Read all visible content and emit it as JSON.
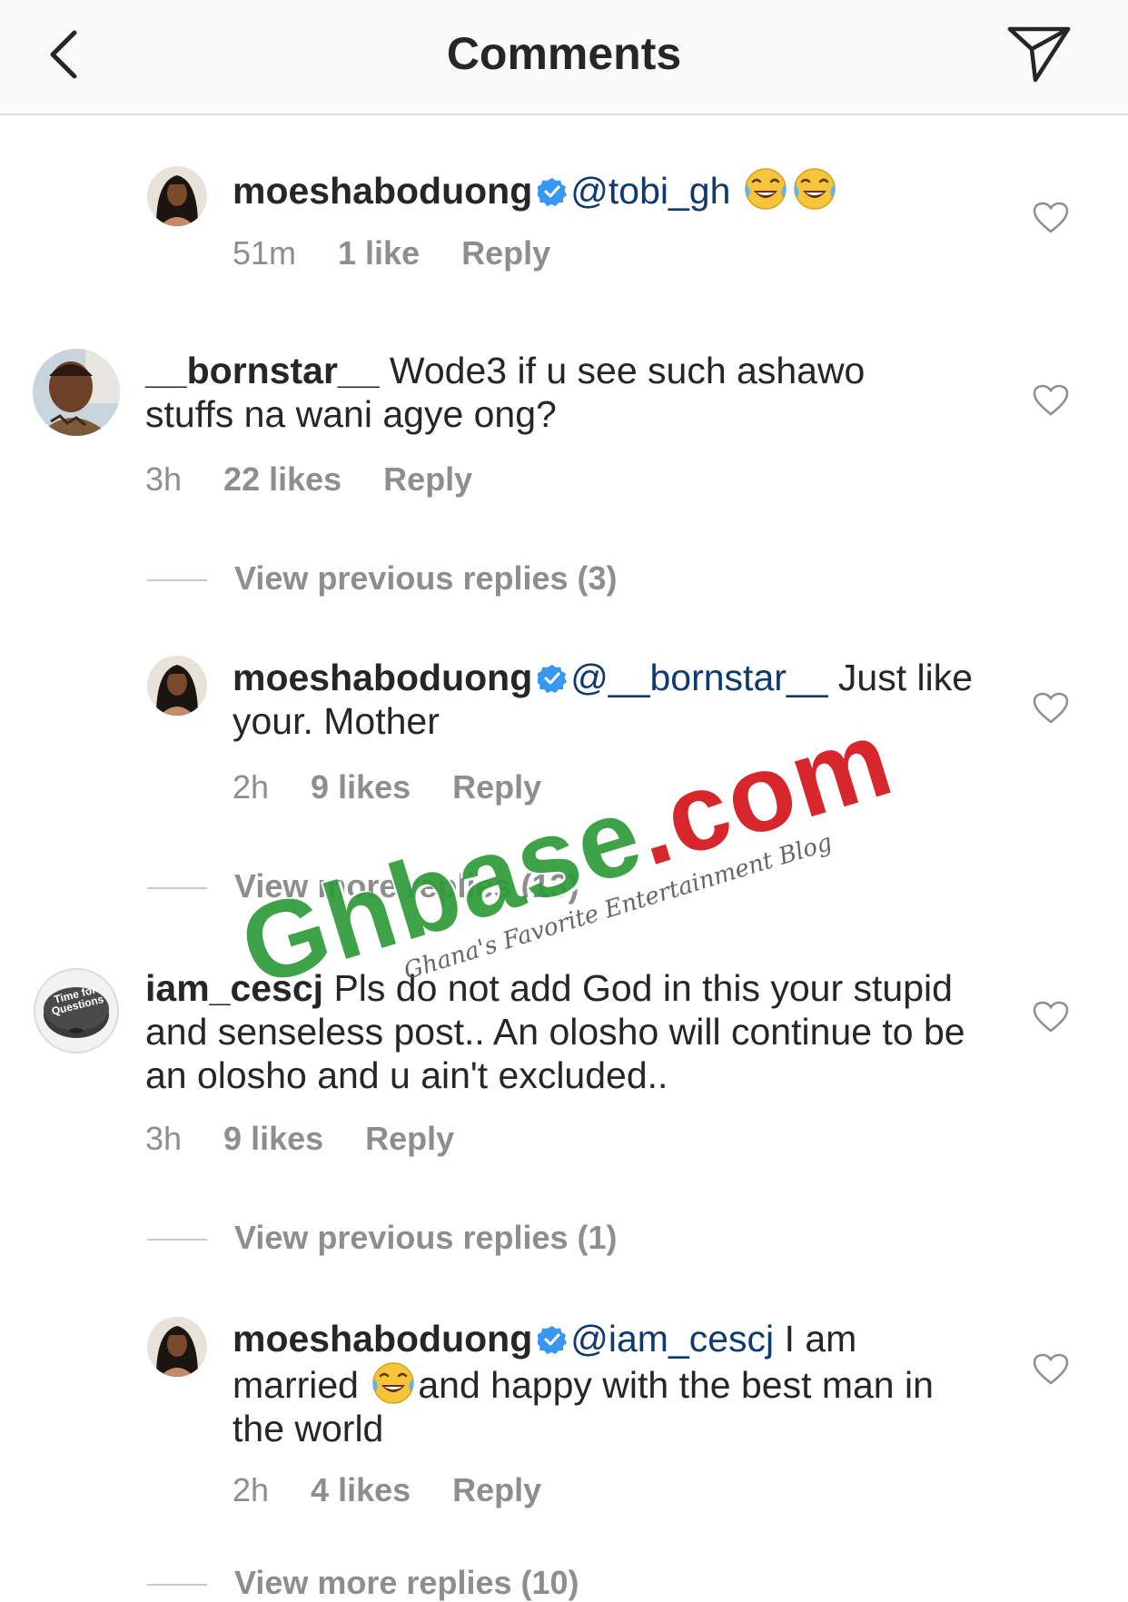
{
  "header": {
    "title": "Comments",
    "back_icon": "chevron-left-icon",
    "send_icon": "paper-plane-icon"
  },
  "comments": [
    {
      "username": "moeshaboduong",
      "verified": true,
      "mention": "@tobi_gh",
      "text": "",
      "emoji": "face-with-tears-of-joy",
      "time": "51m",
      "likes": "1 like",
      "reply": "Reply"
    },
    {
      "username": "__bornstar__",
      "verified": false,
      "text": " Wode3 if u see such ashawo stuffs na wani agye ong?",
      "time": "3h",
      "likes": "22 likes",
      "reply": "Reply"
    },
    {
      "username": "moeshaboduong",
      "verified": true,
      "mention": "@__bornstar__",
      "text": "  Just like your. Mother",
      "time": "2h",
      "likes": "9 likes",
      "reply": "Reply"
    },
    {
      "username": "iam_cescj",
      "verified": false,
      "text": " Pls do not add God in this your stupid and senseless post.. An olosho will continue to be an olosho and u ain't excluded..",
      "time": "3h",
      "likes": "9 likes",
      "reply": "Reply",
      "avatar_text": [
        "Time for",
        "Questions"
      ]
    },
    {
      "username": "moeshaboduong",
      "verified": true,
      "mention": "@iam_cescj",
      "text_before_emoji": "  I am married ",
      "text_after_emoji": "and happy with the best man in the world",
      "emoji": "face-with-tears-of-joy",
      "time": "2h",
      "likes": "4 likes",
      "reply": "Reply"
    }
  ],
  "view_replies": [
    "View previous replies (3)",
    "View more replies (13)",
    "View previous replies (1)",
    "View more replies (10)"
  ],
  "watermark": {
    "main": "Ghbase",
    "dot_com": ".com",
    "tagline": "Ghana's Favorite Entertainment Blog"
  },
  "colors": {
    "text": "#262626",
    "meta": "#8e8e8e",
    "mention": "#0f3a6f",
    "verified": "#3897f0",
    "watermark_green": "#2e9b3a",
    "watermark_red": "#d4151c"
  }
}
